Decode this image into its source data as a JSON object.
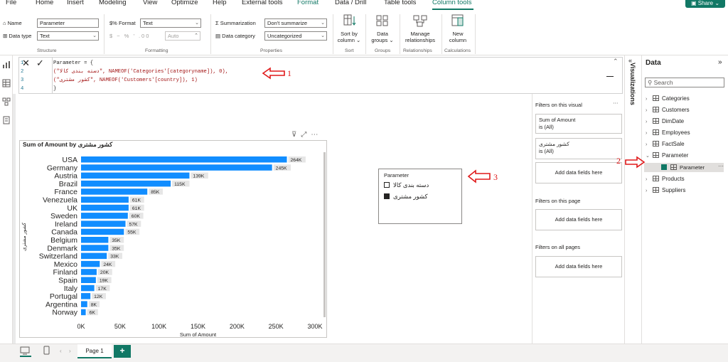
{
  "ribbon_tabs": [
    "File",
    "Home",
    "Insert",
    "Modeling",
    "View",
    "Optimize",
    "Help",
    "External tools",
    "Format",
    "Data / Drill",
    "Table tools",
    "Column tools"
  ],
  "share_label": "Share",
  "structure": {
    "name_label": "Name",
    "name_value": "Parameter",
    "datatype_label": "Data type",
    "datatype_value": "Text",
    "group_label": "Structure"
  },
  "formatting": {
    "format_label": "Format",
    "format_value": "Text",
    "symbols": "$ ~ % ’ .00",
    "auto_value": "Auto",
    "group_label": "Formatting"
  },
  "properties": {
    "summarization_label": "Summarization",
    "summarization_value": "Don't summarize",
    "category_label": "Data category",
    "category_value": "Uncategorized",
    "group_label": "Properties"
  },
  "sort": {
    "btn_label_1": "Sort by",
    "btn_label_2": "column",
    "group_label": "Sort"
  },
  "groups": {
    "btn_label_1": "Data",
    "btn_label_2": "groups",
    "group_label": "Groups"
  },
  "relationships": {
    "btn_label_1": "Manage",
    "btn_label_2": "relationships",
    "group_label": "Relationships"
  },
  "calculations": {
    "btn_label_1": "New",
    "btn_label_2": "column",
    "group_label": "Calculations"
  },
  "formula": {
    "lines": [
      {
        "n": "1",
        "text": "Parameter = {"
      },
      {
        "n": "2",
        "text": "    (\"دسته بندی کالا\", NAMEOF('Categories'[categoryname]), 0),"
      },
      {
        "n": "3",
        "text": "    (\"کشور مشتری\", NAMEOF('Customers'[country]), 1)"
      },
      {
        "n": "4",
        "text": "}"
      }
    ]
  },
  "chart_data": {
    "type": "bar",
    "title": "Sum of Amount by کشور مشتری",
    "xlabel": "Sum of Amount",
    "ylabel": "کشور مشتری",
    "categories": [
      "USA",
      "Germany",
      "Austria",
      "Brazil",
      "France",
      "Venezuela",
      "UK",
      "Sweden",
      "Ireland",
      "Canada",
      "Belgium",
      "Denmark",
      "Switzerland",
      "Mexico",
      "Finland",
      "Spain",
      "Italy",
      "Portugal",
      "Argentina",
      "Norway"
    ],
    "values": [
      264,
      245,
      139,
      115,
      85,
      61,
      61,
      60,
      57,
      55,
      35,
      35,
      33,
      24,
      20,
      19,
      17,
      12,
      8,
      6
    ],
    "data_labels": [
      "264K",
      "245K",
      "139K",
      "115K",
      "85K",
      "61K",
      "61K",
      "60K",
      "57K",
      "55K",
      "35K",
      "35K",
      "33K",
      "24K",
      "20K",
      "19K",
      "17K",
      "12K",
      "8K",
      "6K"
    ],
    "xlim": [
      0,
      300
    ],
    "xticks": [
      "0K",
      "50K",
      "100K",
      "150K",
      "200K",
      "250K",
      "300K"
    ],
    "bar_color": "#118DFF",
    "grid": false
  },
  "slicer": {
    "title": "Parameter",
    "items": [
      {
        "label": "دسته بندی کالا",
        "checked": false
      },
      {
        "label": "کشور مشتری",
        "checked": true
      }
    ]
  },
  "filters": {
    "on_visual": "Filters on this visual",
    "card1_title": "Sum of Amount",
    "card1_value": "is (All)",
    "card2_title": "کشور مشتری",
    "card2_value": "is (All)",
    "add_fields": "Add data fields here",
    "on_page": "Filters on this page",
    "on_all": "Filters on all pages"
  },
  "viz_label": "Visualizations",
  "data_pane": {
    "title": "Data",
    "search_placeholder": "Search",
    "tables": [
      "Categories",
      "Customers",
      "DimDate",
      "Employees",
      "FactSale",
      "Parameter",
      "Products",
      "Suppliers"
    ],
    "child": "Parameter"
  },
  "page_tab": "Page 1",
  "annotations": [
    "1",
    "2",
    "3"
  ],
  "colors": {
    "accent": "#117865",
    "bar": "#118DFF",
    "annotation": "#e0191a"
  }
}
